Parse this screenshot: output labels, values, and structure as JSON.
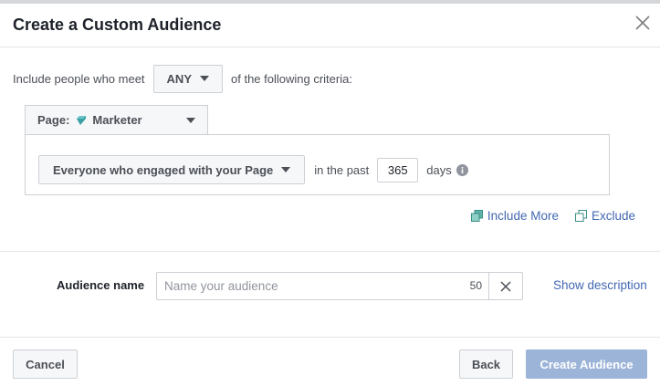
{
  "dialog": {
    "title": "Create a Custom Audience"
  },
  "criteria": {
    "prefix": "Include people who meet",
    "match_value": "ANY",
    "suffix": "of the following criteria:"
  },
  "source": {
    "label": "Page:",
    "page_name": "Marketer",
    "page_icon": "gem-icon"
  },
  "rule": {
    "engagement": "Everyone who engaged with your Page",
    "past_label": "in the past",
    "days_value": "365",
    "days_label": "days"
  },
  "actions": {
    "include_more": "Include More",
    "exclude": "Exclude"
  },
  "audience": {
    "label": "Audience name",
    "placeholder": "Name your audience",
    "char_limit": "50",
    "show_description": "Show description"
  },
  "footer": {
    "cancel": "Cancel",
    "back": "Back",
    "create": "Create Audience"
  },
  "colors": {
    "link": "#4267b2",
    "primary_disabled": "#9cb4d8",
    "icon_teal": "#3b9fa3"
  }
}
